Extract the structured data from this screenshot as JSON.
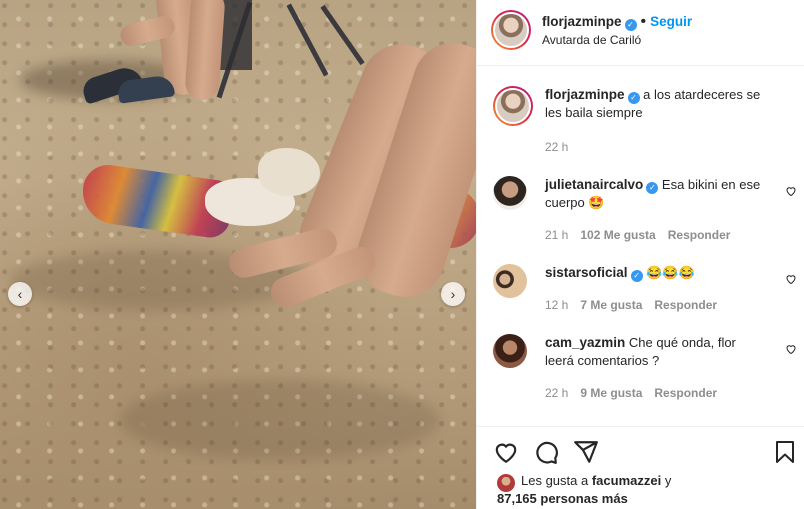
{
  "post": {
    "username": "florjazminpe",
    "follow_label": "Seguir",
    "location": "Avutarda de Cariló"
  },
  "caption": {
    "username": "florjazminpe",
    "text": "a los atardeceres se les baila siempre",
    "time": "22 h"
  },
  "comments": [
    {
      "username": "julietanaircalvo",
      "text": "Esa bikini en ese cuerpo",
      "emoji": "🤩",
      "time": "21 h",
      "likes": "102 Me gusta",
      "reply": "Responder"
    },
    {
      "username": "sistarsoficial",
      "text": "",
      "emoji": "😂😂😂",
      "time": "12 h",
      "likes": "7 Me gusta",
      "reply": "Responder"
    },
    {
      "username": "cam_yazmin",
      "text": "Che qué onda, flor leerá comentarios ?",
      "emoji": "",
      "time": "22 h",
      "likes": "9 Me gusta",
      "reply": "Responder"
    }
  ],
  "likes_line": {
    "prefix": "Les gusta a",
    "user": "facumazzei",
    "suffix": "y",
    "count_text": "87,165 personas más"
  },
  "icons": {
    "verified": "verified-badge-icon",
    "heart": "heart-icon",
    "comment": "comment-icon",
    "share": "share-icon",
    "save": "bookmark-icon",
    "prev": "chevron-left-icon",
    "next": "chevron-right-icon"
  },
  "colors": {
    "accent": "#0095f6",
    "verified": "#3897f0",
    "muted": "#8e8e8e"
  }
}
